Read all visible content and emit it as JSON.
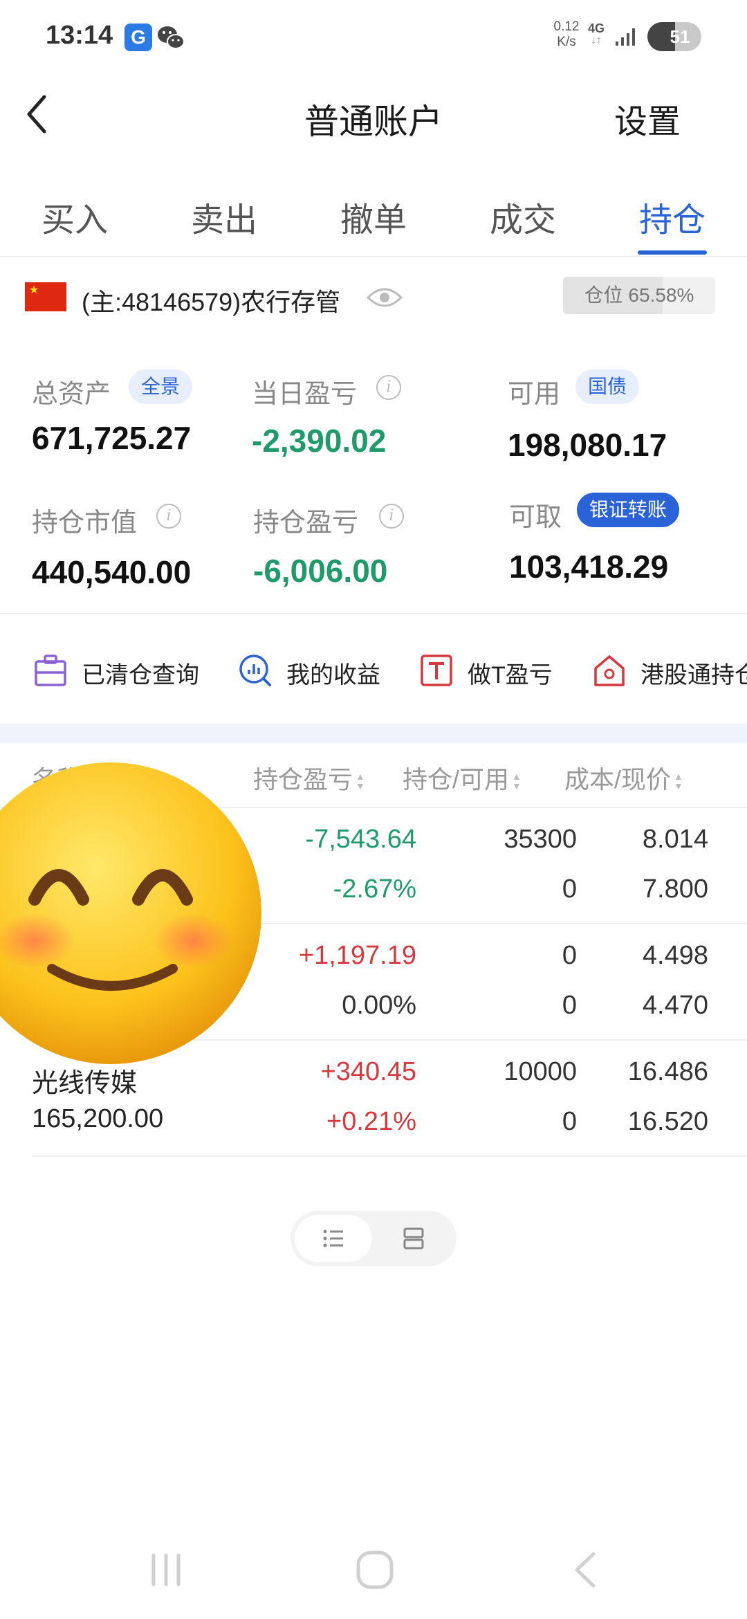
{
  "status_bar": {
    "time": "13:14",
    "net_speed_value": "0.12",
    "net_speed_unit": "K/s",
    "network_type": "4G",
    "battery": "51",
    "battery_level": 0.51,
    "app_icon_letter": "G"
  },
  "header": {
    "title": "普通账户",
    "settings_label": "设置"
  },
  "tabs": [
    {
      "label": "买入",
      "active": false
    },
    {
      "label": "卖出",
      "active": false
    },
    {
      "label": "撤单",
      "active": false
    },
    {
      "label": "成交",
      "active": false
    },
    {
      "label": "持仓",
      "active": true
    }
  ],
  "account": {
    "name": "(主:48146579)农行存管",
    "position_ratio_label": "仓位 65.58%",
    "position_ratio": 0.6558
  },
  "summary": {
    "total_assets": {
      "label": "总资产",
      "badge": "全景",
      "value": "671,725.27"
    },
    "daily_pnl": {
      "label": "当日盈亏",
      "value": "-2,390.02"
    },
    "available": {
      "label": "可用",
      "badge": "国债",
      "value": "198,080.17"
    },
    "market_value": {
      "label": "持仓市值",
      "value": "440,540.00"
    },
    "position_pnl": {
      "label": "持仓盈亏",
      "value": "-6,006.00"
    },
    "withdrawable": {
      "label": "可取",
      "badge": "银证转账",
      "value": "103,418.29"
    }
  },
  "tools": [
    {
      "label": "已清仓查询",
      "icon": "briefcase-icon"
    },
    {
      "label": "我的收益",
      "icon": "chart-search-icon"
    },
    {
      "label": "做T盈亏",
      "icon": "t-box-icon"
    },
    {
      "label": "港股通持仓",
      "icon": "hk-home-icon"
    }
  ],
  "table": {
    "headers": [
      "名称/市值",
      "持仓盈亏",
      "持仓/可用",
      "成本/现价"
    ],
    "rows": [
      {
        "name": "",
        "value": "",
        "pnl": "-7,543.64",
        "pnl_pct": "-2.67%",
        "hold": "35300",
        "avail": "0",
        "cost": "8.014",
        "price": "7.800",
        "pnl_color": "green"
      },
      {
        "name": "",
        "value": "",
        "pnl": "+1,197.19",
        "pnl_pct": "0.00%",
        "hold": "0",
        "avail": "0",
        "cost": "4.498",
        "price": "4.470",
        "pnl_color": "red"
      },
      {
        "name": "光线传媒",
        "value": "165,200.00",
        "pnl": "+340.45",
        "pnl_pct": "+0.21%",
        "hold": "10000",
        "avail": "0",
        "cost": "16.486",
        "price": "16.520",
        "pnl_color": "red"
      }
    ]
  },
  "colors": {
    "accent": "#2a62d8",
    "loss": "#1f9a6b",
    "gain": "#d6393d"
  }
}
